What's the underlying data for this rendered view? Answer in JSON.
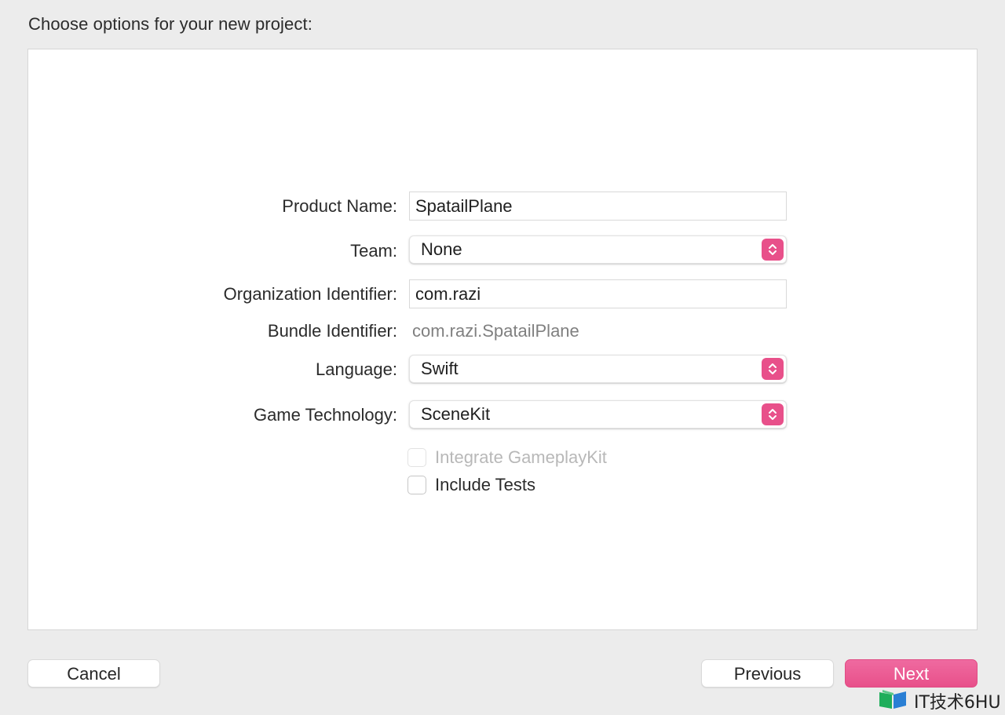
{
  "dialog": {
    "title": "Choose options for your new project:"
  },
  "form": {
    "product_name": {
      "label": "Product Name:",
      "value": "SpatailPlane"
    },
    "team": {
      "label": "Team:",
      "value": "None"
    },
    "organization_identifier": {
      "label": "Organization Identifier:",
      "value": "com.razi"
    },
    "bundle_identifier": {
      "label": "Bundle Identifier:",
      "value": "com.razi.SpatailPlane"
    },
    "language": {
      "label": "Language:",
      "value": "Swift"
    },
    "game_technology": {
      "label": "Game Technology:",
      "value": "SceneKit"
    },
    "integrate_gameplaykit": {
      "label": "Integrate GameplayKit",
      "checked": false,
      "enabled": false
    },
    "include_tests": {
      "label": "Include Tests",
      "checked": false,
      "enabled": true
    }
  },
  "buttons": {
    "cancel": "Cancel",
    "previous": "Previous",
    "next": "Next"
  },
  "watermark": {
    "text": "IT技术6HU"
  },
  "colors": {
    "accent": "#e8508a",
    "background": "#ececec",
    "panel": "#ffffff"
  },
  "icons": {
    "stepper": "chevron-up-down-icon",
    "watermark_logo": "book-icon"
  }
}
